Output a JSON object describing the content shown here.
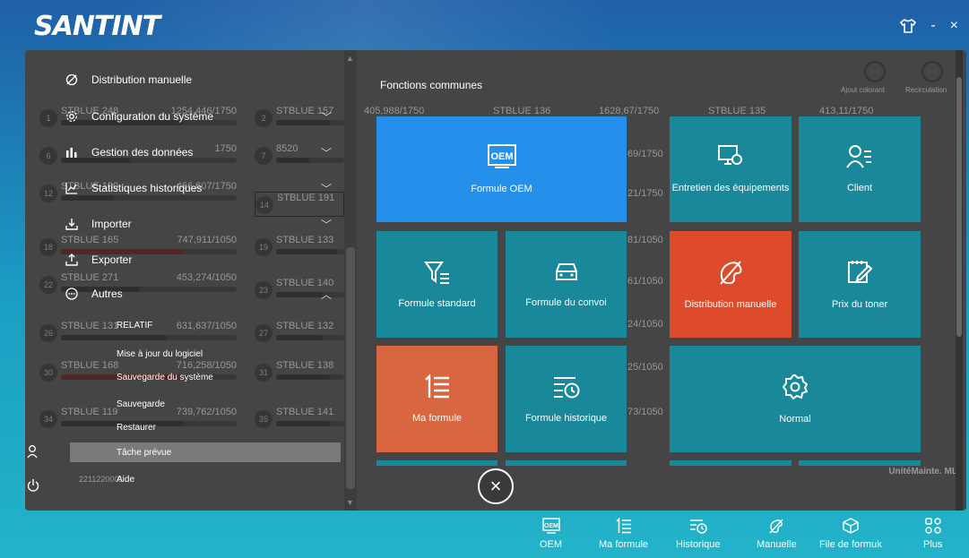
{
  "app": {
    "logo": "SANTINT"
  },
  "window_controls": {
    "skin": "⛉",
    "minimize": "-",
    "close": "×"
  },
  "background": {
    "footer_text": "UnitéMainte. ML",
    "top_right": [
      "Ajout colorant",
      "Recirculation"
    ],
    "slots_left": [
      {
        "num": "1",
        "name": "STBLUE 248",
        "val": "1254,446/1750"
      },
      {
        "num": "6",
        "name": "",
        "val": "1750"
      },
      {
        "num": "12",
        "name": "STBLUE 190",
        "val": "466,607/1750"
      },
      {
        "num": "18",
        "name": "STBLUE 165",
        "val": "747,911/1050"
      },
      {
        "num": "22",
        "name": "STBLUE 271",
        "val": "453,274/1050"
      },
      {
        "num": "26",
        "name": "STBLUE 131",
        "val": "631,637/1050"
      },
      {
        "num": "30",
        "name": "STBLUE 168",
        "val": "716,258/1050"
      },
      {
        "num": "34",
        "name": "STBLUE 119",
        "val": "739,762/1050"
      }
    ],
    "slots_mid": [
      {
        "num": "2",
        "name": "STBLUE 157"
      },
      {
        "num": "7",
        "name": "8520"
      },
      {
        "num": "14",
        "name": "STBLUE 191"
      },
      {
        "num": "19",
        "name": "STBLUE 133"
      },
      {
        "num": "23",
        "name": "STBLUE 140"
      },
      {
        "num": "27",
        "name": "STBLUE 132"
      },
      {
        "num": "31",
        "name": "STBLUE 138"
      },
      {
        "num": "35",
        "name": "STBLUE 141"
      }
    ],
    "slots_top": [
      {
        "name": "405,988/1750"
      },
      {
        "name": "STBLUE 136"
      },
      {
        "name": "1628,67/1750"
      },
      {
        "name": "STBLUE 135"
      },
      {
        "name": "413,11/1750"
      }
    ],
    "right_vals": [
      "69/1750",
      "21/1750",
      "81/1050",
      "61/1050",
      "24/1050",
      "25/1050",
      "73/1050"
    ],
    "device_id": "2211220001"
  },
  "menu": {
    "items": [
      {
        "label": "Distribution manuelle",
        "icon": "manual-icon"
      },
      {
        "label": "Configuration du système",
        "icon": "gear-icon"
      },
      {
        "label": "Gestion des données",
        "icon": "data-icon"
      },
      {
        "label": "Statistiques historiques",
        "icon": "stats-icon"
      },
      {
        "label": "Importer",
        "icon": "import-icon"
      },
      {
        "label": "Exporter",
        "icon": "export-icon"
      },
      {
        "label": "Autres",
        "icon": "more-icon"
      }
    ],
    "sub_items": [
      "RELATIF",
      "Mise à jour du logiciel",
      "Sauvegarde du système",
      "Sauvegarde",
      "Restaurer",
      "Tâche prévue",
      "Aide"
    ]
  },
  "functions": {
    "title": "Fonctions communes",
    "tiles": {
      "oem": {
        "label": "Formule OEM",
        "icon_text": "OEM"
      },
      "maintenance": {
        "label": "Entretien des équipements"
      },
      "client": {
        "label": "Client"
      },
      "standard": {
        "label": "Formule standard"
      },
      "convoy": {
        "label": "Formule du convoi"
      },
      "manual": {
        "label": "Distribution manuelle"
      },
      "toner": {
        "label": "Prix du toner"
      },
      "my_formula": {
        "label": "Ma formule"
      },
      "history": {
        "label": "Formule historique"
      },
      "normal": {
        "label": "Normal"
      }
    },
    "colors": {
      "teal": "#18889a",
      "blue": "#2490ec",
      "red": "#de4b2b",
      "orange": "#d86640"
    }
  },
  "close_button": {
    "label": "×"
  },
  "bottom_nav": [
    {
      "label": "OEM",
      "icon": "oem-icon",
      "icon_text": "OEM"
    },
    {
      "label": "Ma formule",
      "icon": "list-icon"
    },
    {
      "label": "Historique",
      "icon": "history-icon"
    },
    {
      "label": "Manuelle",
      "icon": "manual-icon"
    },
    {
      "label": "File de formuk",
      "icon": "queue-icon"
    },
    {
      "label": "Plus",
      "icon": "more-icon"
    }
  ]
}
